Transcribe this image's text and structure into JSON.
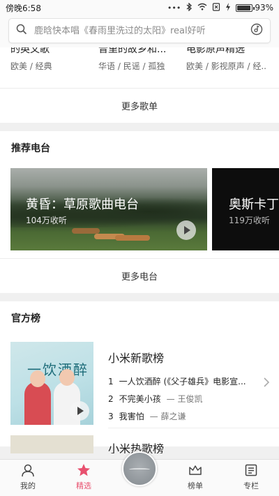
{
  "status": {
    "time": "傍晚6:58",
    "battery": "93%",
    "battery_level": 0.93
  },
  "search": {
    "placeholder": "鹿晗快本唱《春雨里洗过的太阳》real好听"
  },
  "songlists": [
    {
      "title": "的英文歌",
      "tags": "欧美 / 经典"
    },
    {
      "title": "音里的故乡和...",
      "tags": "华语 / 民谣 / 孤独"
    },
    {
      "title": "电影原声精选",
      "tags": "欧美 / 影视原声 / 经..."
    }
  ],
  "more_songlists": "更多歌单",
  "radio": {
    "title": "推荐电台",
    "items": [
      {
        "title": "黄昏：草原歌曲电台",
        "listens": "104万收听"
      },
      {
        "title": "奥斯卡丁",
        "listens": "119万收听"
      }
    ],
    "more": "更多电台"
  },
  "charts": {
    "title": "官方榜",
    "items": [
      {
        "name": "小米新歌榜",
        "cover_text": "一饮酒醉",
        "tracks": [
          {
            "no": "1",
            "song": "一人饮酒醉 (《父子雄兵》电影宣...",
            "artist": ""
          },
          {
            "no": "2",
            "song": "不完美小孩",
            "artist": "— 王俊凯"
          },
          {
            "no": "3",
            "song": "我害怕",
            "artist": "— 薛之谦"
          }
        ]
      },
      {
        "name": "小米热歌榜"
      }
    ]
  },
  "tabs": [
    {
      "label": "我的",
      "icon": "person-icon"
    },
    {
      "label": "精选",
      "icon": "star-icon"
    },
    {
      "label": "",
      "icon": "disc-icon"
    },
    {
      "label": "榜单",
      "icon": "crown-icon"
    },
    {
      "label": "专栏",
      "icon": "column-icon"
    }
  ],
  "colors": {
    "accent": "#e8516f"
  }
}
